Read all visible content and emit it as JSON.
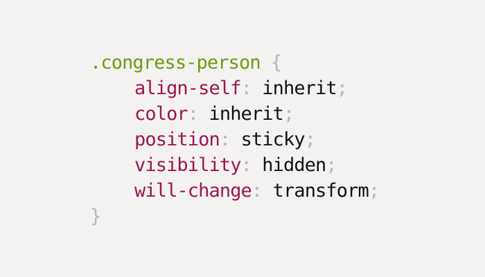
{
  "selector": ".congress-person",
  "open_brace": "{",
  "close_brace": "}",
  "colon": ":",
  "semicolon": ";",
  "declarations": [
    {
      "property": "align-self",
      "value": "inherit"
    },
    {
      "property": "color",
      "value": "inherit"
    },
    {
      "property": "position",
      "value": "sticky"
    },
    {
      "property": "visibility",
      "value": "hidden"
    },
    {
      "property": "will-change",
      "value": "transform"
    }
  ],
  "colors": {
    "background": "#f4f2f0",
    "selector": "#6f9a12",
    "property": "#9a1555",
    "value": "#111111",
    "punctuation": "#b7b7b7"
  }
}
